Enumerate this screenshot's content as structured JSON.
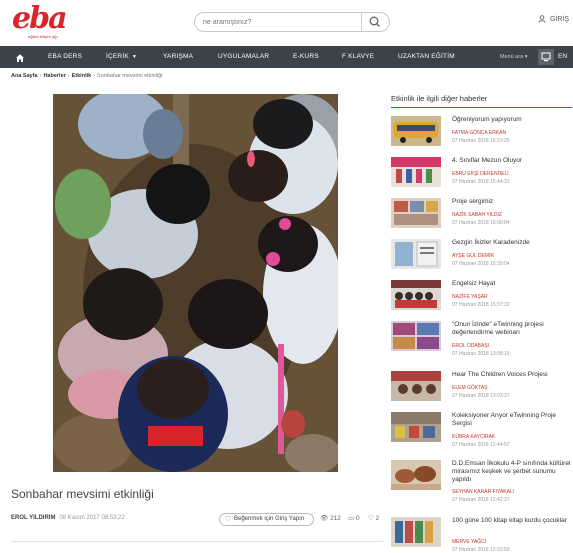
{
  "header": {
    "logo_text": "eba",
    "logo_sub": "eğitim bilişim ağı",
    "search_placeholder": "ne aramıştınız?",
    "login_label": "GİRİŞ"
  },
  "nav": {
    "items": [
      "EBA DERS",
      "İÇERİK",
      "YARIŞMA",
      "UYGULAMALAR",
      "E-KURS",
      "F KLAVYE",
      "UZAKTAN EĞİTİM"
    ],
    "menu_label": "Menü ara",
    "lang": "EN"
  },
  "breadcrumb": {
    "home": "Ana Sayfa",
    "section": "Haberler",
    "category": "Etkinlik",
    "current": "Sonbahar mevsimi etkinliği"
  },
  "article": {
    "title": "Sonbahar mevsimi etkinliği",
    "author": "EROL YILDIRIM",
    "date": "08 Kasım 2017 08:53:22",
    "like_label": "Beğenmek için Giriş Yapın",
    "views": "212",
    "comments": "0",
    "likes": "2"
  },
  "sidebar": {
    "title": "Etkinlik ile ilgili diğer haberler",
    "items": [
      {
        "title": "Öğreniyorum yapıyorum",
        "author": "FATMA GONCA ERKAN",
        "date": "07 Haziran 2018 16:23:25"
      },
      {
        "title": "4. Sınıflar Mezun Oluyor",
        "author": "EBRU EKŞİ DERENDELİ",
        "date": "07 Haziran 2018 15:44:31"
      },
      {
        "title": "Proje sergimiz",
        "author": "NAZİK SABAH YILDIZ",
        "date": "07 Haziran 2018 15:00:04"
      },
      {
        "title": "Gezgin İkizler Karadenizde",
        "author": "AYŞE GÜL DEMİR",
        "date": "07 Haziran 2018 15:39:04"
      },
      {
        "title": "Engelsiz Hayat",
        "author": "NAZİFE YAŞAR",
        "date": "07 Haziran 2018 15:37:32"
      },
      {
        "title": "\"Onun İzinde\" eTwinning projesi değerlendirme webinarı",
        "author": "EROL ODABAŞI",
        "date": "07 Haziran 2018 13:08:19"
      },
      {
        "title": "Hear The Children Voices Projesi",
        "author": "ELEM GÖKTAŞ",
        "date": "07 Haziran 2018 13:03:37"
      },
      {
        "title": "Koleksiyoner Arıyor eTwinning Proje Sergisi",
        "author": "KÜBRA KAYCIRAK",
        "date": "07 Haziran 2018 12:44:57"
      },
      {
        "title": "D.D.Emsan İlkokulu 4-P sınıfında kültürel mirasımız keşkek ve şerbet sunumu yapıldı",
        "author": "SEYHAN KARAR FIYAKALI",
        "date": "07 Haziran 2018 12:42:37"
      },
      {
        "title": "100 güne 100 kitap kitap kurdu çocuklar",
        "author": "MERVE YAĞCI",
        "date": "07 Haziran 2018 12:33:50"
      }
    ]
  },
  "colors": {
    "brand_red": "#d9262b",
    "nav_bg": "#3b4249"
  }
}
